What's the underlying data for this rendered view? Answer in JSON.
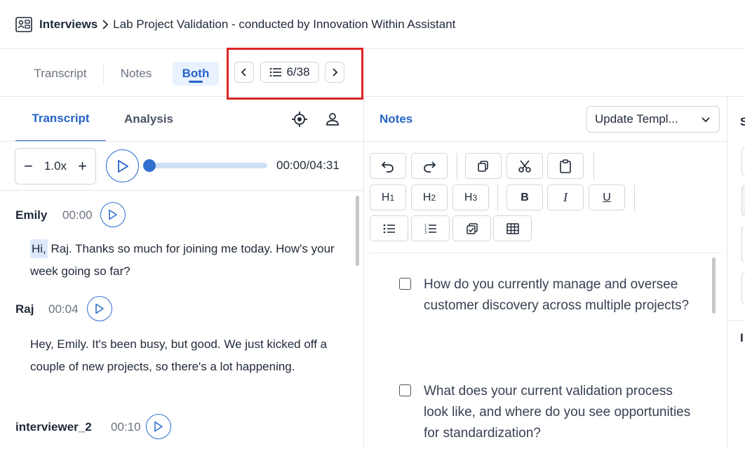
{
  "header": {
    "icon": "interviews-icon",
    "root": "Interviews",
    "separator_icon": "chevron-right-icon",
    "title": "Lab Project Validation - conducted by Innovation Within Assistant"
  },
  "view_tabs": [
    {
      "label": "Transcript",
      "active": false
    },
    {
      "label": "Notes",
      "active": false
    },
    {
      "label": "Both",
      "active": true
    }
  ],
  "pager": {
    "prev_icon": "chevron-left-icon",
    "list_icon": "list-icon",
    "count": "6/38",
    "next_icon": "chevron-right-icon"
  },
  "left_panel": {
    "tabs": [
      {
        "label": "Transcript",
        "active": true
      },
      {
        "label": "Analysis",
        "active": false
      }
    ],
    "icons": [
      "target-icon",
      "person-icon"
    ],
    "player": {
      "speed": "1.0x",
      "minus": "−",
      "plus": "+",
      "time": "00:00/04:31",
      "progress": 0
    },
    "utterances": [
      {
        "speaker": "Emily",
        "time": "00:00",
        "highlight": "Hi,",
        "text": " Raj. Thanks so much for joining me today. How's your week going so far?"
      },
      {
        "speaker": "Raj",
        "time": "00:04",
        "highlight": "",
        "text": "Hey, Emily. It's been busy, but good. We just kicked off a couple of new projects, so there's a lot happening."
      },
      {
        "speaker": "interviewer_2",
        "time": "00:10",
        "highlight": "",
        "text": ""
      }
    ]
  },
  "notes_panel": {
    "title": "Notes",
    "template_button": "Update Templ...",
    "toolbar": {
      "undo": "undo-icon",
      "redo": "redo-icon",
      "copy": "copy-icon",
      "cut": "scissors-icon",
      "paste": "clipboard-icon",
      "h1": "H",
      "h1_sub": "1",
      "h2": "H",
      "h2_sub": "2",
      "h3": "H",
      "h3_sub": "3",
      "bold": "B",
      "italic": "I",
      "underline": "U",
      "bullet": "bullet-list-icon",
      "numbered": "numbered-list-icon",
      "checklist": "checklist-icon",
      "table": "table-icon"
    },
    "questions": [
      {
        "checked": false,
        "text": "How do you currently manage and oversee customer discovery across multiple projects?"
      },
      {
        "checked": false,
        "text": "What does your current validation process look like, and where do you see opportunities for standardization?"
      }
    ]
  },
  "right_panel": {
    "label_top": "S",
    "label_bottom": "I"
  },
  "colors": {
    "accent": "#2563c9",
    "highlight_box": "#dc2626",
    "border": "#e5e7eb",
    "active_tab_bg": "#e8f1fd"
  }
}
